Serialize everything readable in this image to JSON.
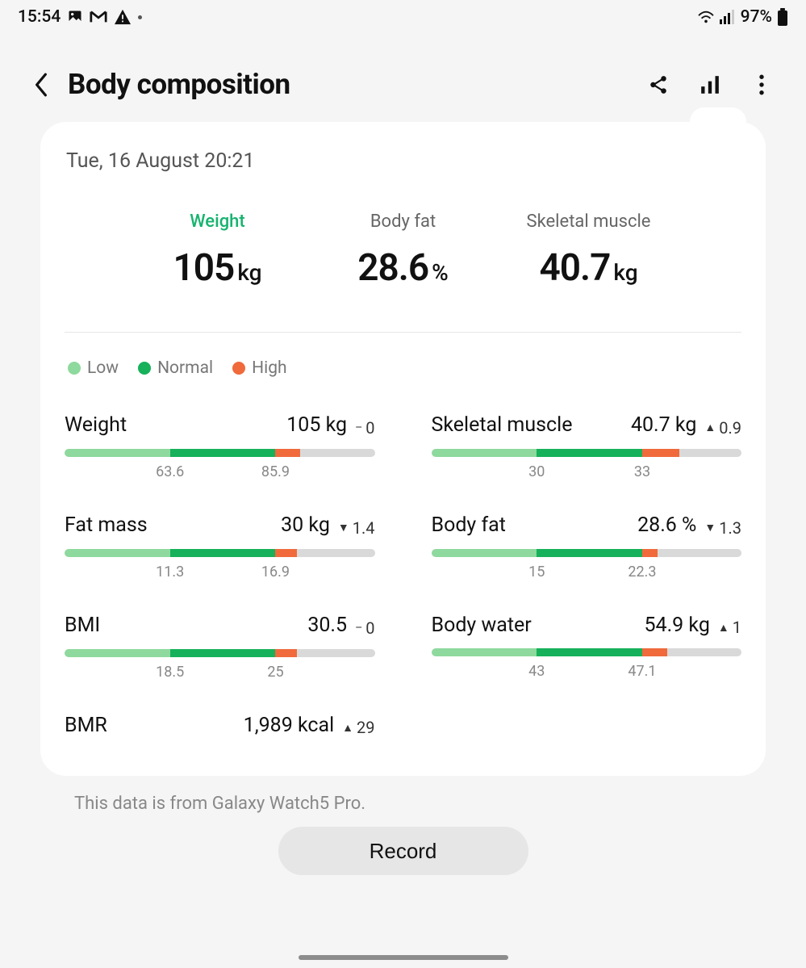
{
  "status": {
    "time": "15:54",
    "battery": "97%"
  },
  "header": {
    "title": "Body composition"
  },
  "colors": {
    "accent": "#17b36f",
    "low": "#8ed99d",
    "normal": "#16b15a",
    "high": "#f06a3b",
    "rest": "#d9d9d9"
  },
  "date": "Tue, 16 August 20:21",
  "top_metrics": [
    {
      "label": "Weight",
      "value": "105",
      "unit": "kg",
      "active": true
    },
    {
      "label": "Body fat",
      "value": "28.6",
      "unit": "%",
      "active": false
    },
    {
      "label": "Skeletal muscle",
      "value": "40.7",
      "unit": "kg",
      "active": false
    }
  ],
  "legend": {
    "low": "Low",
    "normal": "Normal",
    "high": "High"
  },
  "metrics": [
    {
      "name": "Weight",
      "value": "105 kg",
      "delta_dir": "flat",
      "delta": "0",
      "ticks": [
        "63.6",
        "85.9"
      ],
      "widths": [
        34,
        34,
        8,
        24
      ]
    },
    {
      "name": "Skeletal muscle",
      "value": "40.7 kg",
      "delta_dir": "up",
      "delta": "0.9",
      "ticks": [
        "30",
        "33"
      ],
      "widths": [
        34,
        34,
        12,
        20
      ]
    },
    {
      "name": "Fat mass",
      "value": "30 kg",
      "delta_dir": "down",
      "delta": "1.4",
      "ticks": [
        "11.3",
        "16.9"
      ],
      "widths": [
        34,
        34,
        7,
        25
      ]
    },
    {
      "name": "Body fat",
      "value": "28.6 %",
      "delta_dir": "down",
      "delta": "1.3",
      "ticks": [
        "15",
        "22.3"
      ],
      "widths": [
        34,
        34,
        5,
        27
      ]
    },
    {
      "name": "BMI",
      "value": "30.5",
      "delta_dir": "flat",
      "delta": "0",
      "ticks": [
        "18.5",
        "25"
      ],
      "widths": [
        34,
        34,
        7,
        25
      ]
    },
    {
      "name": "Body water",
      "value": "54.9 kg",
      "delta_dir": "up",
      "delta": "1",
      "ticks": [
        "43",
        "47.1"
      ],
      "widths": [
        34,
        34,
        8,
        24
      ]
    },
    {
      "name": "BMR",
      "value": "1,989 kcal",
      "delta_dir": "up",
      "delta": "29",
      "ticks": [],
      "widths": null
    }
  ],
  "source_note": "This data is from Galaxy Watch5 Pro.",
  "record_button": "Record",
  "chart_data": {
    "type": "bar",
    "note": "Horizontal zone bars: each metric marked against Low/Normal/High ranges",
    "items": [
      {
        "name": "Weight",
        "value": 105,
        "unit": "kg",
        "low_upper": 63.6,
        "normal_upper": 85.9,
        "delta": 0
      },
      {
        "name": "Skeletal muscle",
        "value": 40.7,
        "unit": "kg",
        "low_upper": 30,
        "normal_upper": 33,
        "delta": 0.9
      },
      {
        "name": "Fat mass",
        "value": 30,
        "unit": "kg",
        "low_upper": 11.3,
        "normal_upper": 16.9,
        "delta": -1.4
      },
      {
        "name": "Body fat",
        "value": 28.6,
        "unit": "%",
        "low_upper": 15,
        "normal_upper": 22.3,
        "delta": -1.3
      },
      {
        "name": "BMI",
        "value": 30.5,
        "unit": "",
        "low_upper": 18.5,
        "normal_upper": 25,
        "delta": 0
      },
      {
        "name": "Body water",
        "value": 54.9,
        "unit": "kg",
        "low_upper": 43,
        "normal_upper": 47.1,
        "delta": 1
      },
      {
        "name": "BMR",
        "value": 1989,
        "unit": "kcal",
        "delta": 29
      }
    ]
  }
}
